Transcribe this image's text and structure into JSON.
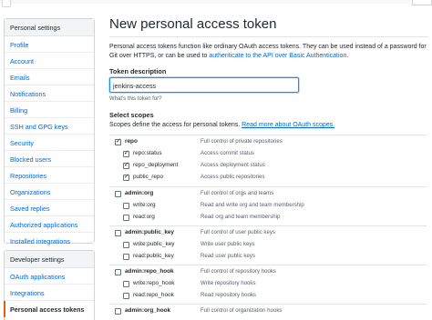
{
  "sidebar": {
    "personal": {
      "heading": "Personal settings",
      "items": [
        "Profile",
        "Account",
        "Emails",
        "Notifications",
        "Billing",
        "SSH and GPG keys",
        "Security",
        "Blocked users",
        "Repositories",
        "Organizations",
        "Saved replies",
        "Authorized applications",
        "Installed integrations"
      ]
    },
    "developer": {
      "heading": "Developer settings",
      "items": [
        "OAuth applications",
        "Integrations",
        "Personal access tokens"
      ],
      "active_item": "Personal access tokens"
    }
  },
  "main": {
    "title": "New personal access token",
    "intro_text": "Personal access tokens function like ordinary OAuth access tokens. They can be used instead of a password for Git over HTTPS, or can be used to",
    "intro_link": "authenticate to the API over Basic Authentication",
    "intro_end": ".",
    "token_description": {
      "label": "Token description",
      "value": "jenkins-access",
      "note": "What's this token for?"
    },
    "scopes": {
      "label": "Select scopes",
      "description": "Scopes define the access for personal tokens.",
      "description_link": "Read more about OAuth scopes.",
      "groups": [
        {
          "name": "repo",
          "checked": true,
          "desc": "Full control of private repositories",
          "children": [
            {
              "name": "repo:status",
              "checked": true,
              "desc": "Access commit status"
            },
            {
              "name": "repo_deployment",
              "checked": true,
              "desc": "Access deployment status"
            },
            {
              "name": "public_repo",
              "checked": true,
              "desc": "Access public repositories"
            }
          ]
        },
        {
          "name": "admin:org",
          "checked": false,
          "desc": "Full control of orgs and teams",
          "children": [
            {
              "name": "write:org",
              "checked": false,
              "desc": "Read and write org and team membership"
            },
            {
              "name": "read:org",
              "checked": false,
              "desc": "Read org and team membership"
            }
          ]
        },
        {
          "name": "admin:public_key",
          "checked": false,
          "desc": "Full control of user public keys",
          "children": [
            {
              "name": "write:public_key",
              "checked": false,
              "desc": "Write user public keys"
            },
            {
              "name": "read:public_key",
              "checked": false,
              "desc": "Read user public keys"
            }
          ]
        },
        {
          "name": "admin:repo_hook",
          "checked": false,
          "desc": "Full control of repository hooks",
          "children": [
            {
              "name": "write:repo_hook",
              "checked": false,
              "desc": "Write repository hooks"
            },
            {
              "name": "read:repo_hook",
              "checked": false,
              "desc": "Read repository hooks"
            }
          ]
        },
        {
          "name": "admin:org_hook",
          "checked": false,
          "desc": "Full control of organization hooks",
          "children": []
        }
      ]
    }
  }
}
